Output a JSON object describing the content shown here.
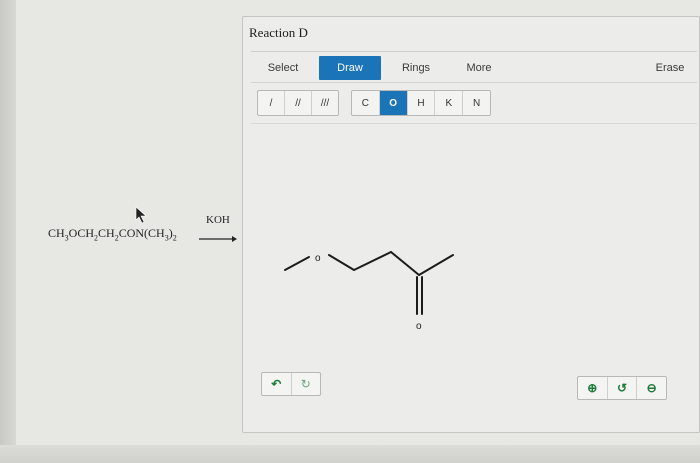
{
  "question": {
    "reactant_parts": [
      {
        "t": "CH"
      },
      {
        "s": "3"
      },
      {
        "t": "OCH"
      },
      {
        "s": "2"
      },
      {
        "t": "CH"
      },
      {
        "s": "2"
      },
      {
        "t": "CON(CH"
      },
      {
        "s": "3"
      },
      {
        "t": ")"
      },
      {
        "s": "2"
      }
    ],
    "reagent": "KOH"
  },
  "panel": {
    "title": "Reaction D",
    "tabs": {
      "select": "Select",
      "draw": "Draw",
      "rings": "Rings",
      "more": "More",
      "erase": "Erase"
    },
    "bonds": [
      "/",
      "//",
      "///"
    ],
    "atoms": [
      "C",
      "O",
      "H",
      "K",
      "N"
    ],
    "active_atom": "O",
    "drawn_atoms": {
      "o1": "o",
      "o2": "o"
    },
    "bottom_tools": {
      "undo": "↶",
      "redo": "↻",
      "zoom_in": "⊕",
      "reset": "↺",
      "zoom_out": "⊖"
    }
  },
  "colors": {
    "accent": "#1b73b8",
    "tool_green": "#1e7a3a"
  }
}
